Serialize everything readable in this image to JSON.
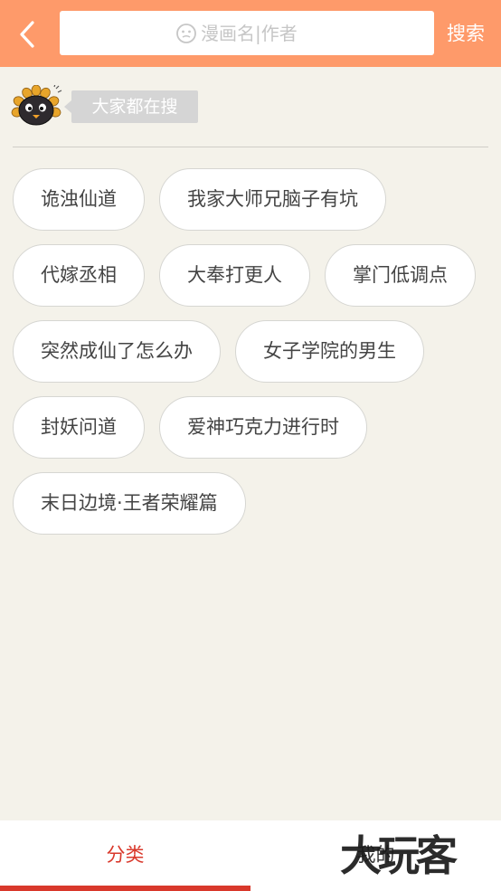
{
  "header": {
    "search_placeholder": "漫画名|作者",
    "search_button": "搜索",
    "bg_color": "#fe9a6a"
  },
  "hot": {
    "title": "大家都在搜",
    "tags": [
      {
        "label": "诡浊仙道"
      },
      {
        "label": "我家大师兄脑子有坑"
      },
      {
        "label": "代嫁丞相"
      },
      {
        "label": "大奉打更人"
      },
      {
        "label": "掌门低调点"
      },
      {
        "label": "突然成仙了怎么办"
      },
      {
        "label": "女子学院的男生"
      },
      {
        "label": "封妖问道"
      },
      {
        "label": "爱神巧克力进行时"
      },
      {
        "label": "末日边境·王者荣耀篇"
      }
    ]
  },
  "tabbar": {
    "category_label": "分类",
    "mine_label": "我的",
    "active_color": "#d9382b"
  },
  "watermark": {
    "text": "大玩客"
  }
}
